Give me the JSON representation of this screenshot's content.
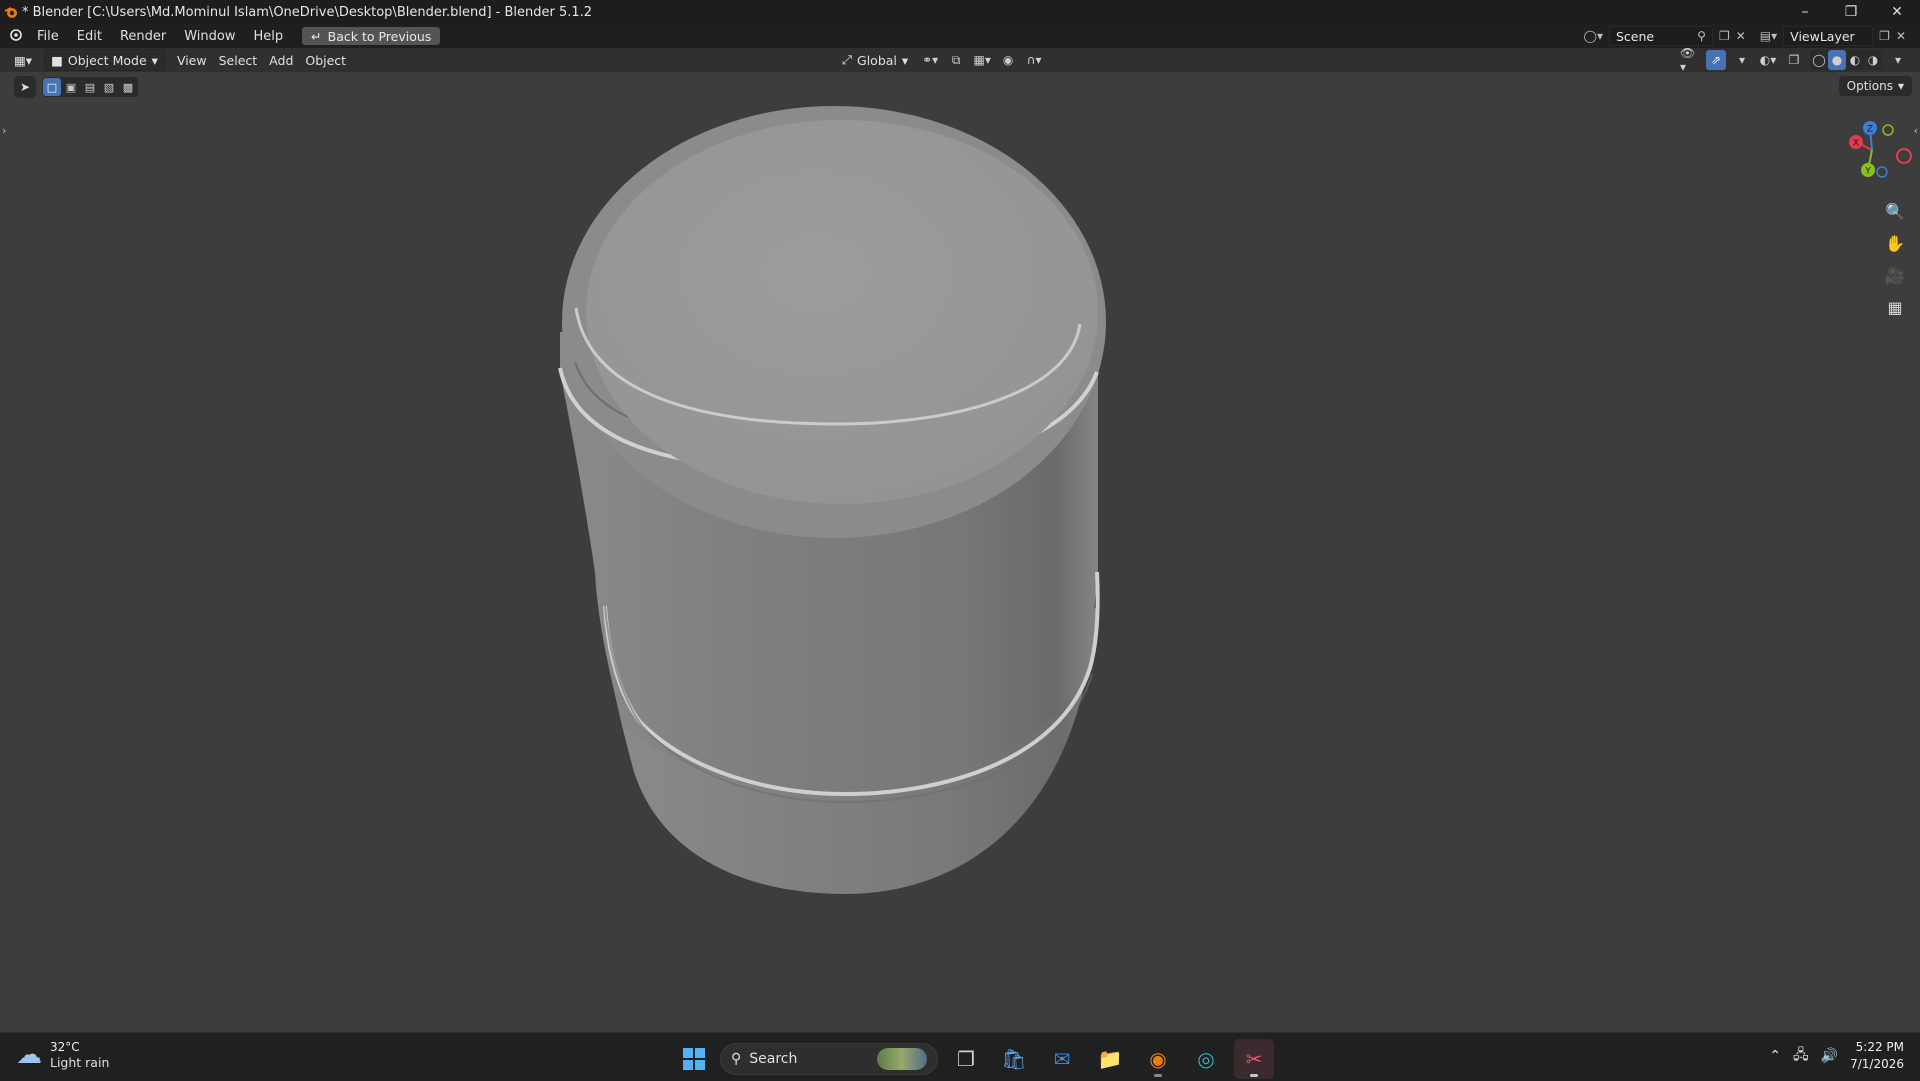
{
  "window": {
    "title": "* Blender [C:\\Users\\Md.Mominul Islam\\OneDrive\\Desktop\\Blender.blend] - Blender 5.1.2",
    "controls": [
      "minimize-icon",
      "restore-icon",
      "close-icon"
    ]
  },
  "menubar": {
    "items": [
      "File",
      "Edit",
      "Render",
      "Window",
      "Help"
    ],
    "back_button": "Back to Previous",
    "scene_label": "Scene",
    "view_layer_label": "ViewLayer"
  },
  "header": {
    "mode": "Object Mode",
    "menus": [
      "View",
      "Select",
      "Add",
      "Object"
    ],
    "transform_orientation": "Global",
    "options_label": "Options"
  },
  "viewport": {
    "object": "cylinder-mesh",
    "gizmo_axes": [
      "X",
      "Y",
      "Z"
    ],
    "colors": {
      "background": "#3d3d3d",
      "x_axis": "#e23b4e",
      "y_axis": "#84c21b",
      "z_axis": "#3b7fd6",
      "accent": "#4772b3"
    }
  },
  "taskbar": {
    "weather_temp": "32°C",
    "weather_condition": "Light rain",
    "search_placeholder": "Search",
    "time": "5:22 PM",
    "date": "7/1/2026"
  }
}
